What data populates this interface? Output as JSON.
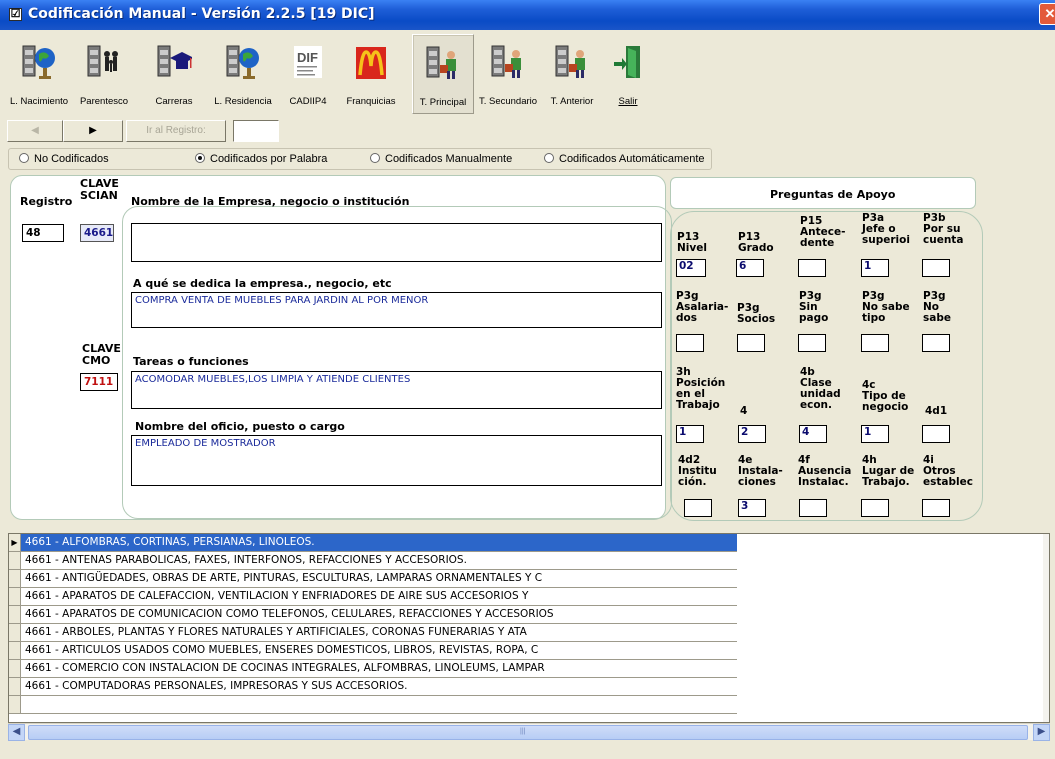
{
  "window": {
    "title": "Codificación Manual - Versión 2.2.5 [19 DIC]",
    "check_glyph": "☑",
    "close_glyph": "✕"
  },
  "toolbar": {
    "items": [
      {
        "label": "L. Nacimiento",
        "icon": "cabinet-globe-icon"
      },
      {
        "label": "Parentesco",
        "icon": "cabinet-family-icon"
      },
      {
        "label": "Carreras",
        "icon": "cabinet-graduation-icon"
      },
      {
        "label": "L. Residencia",
        "icon": "cabinet-globe-icon"
      },
      {
        "label": "CADIIP4",
        "icon": "dif-logo-icon",
        "badge": "DIF"
      },
      {
        "label": "Franquicias",
        "icon": "mcdonalds-icon",
        "badge": "M"
      },
      {
        "label": "T. Principal",
        "icon": "cabinet-worker-icon"
      },
      {
        "label": "T. Secundario",
        "icon": "cabinet-worker-icon"
      },
      {
        "label": "T. Anterior",
        "icon": "cabinet-worker-icon"
      },
      {
        "label": "Salir",
        "icon": "exit-door-icon"
      }
    ],
    "active_index": 6
  },
  "nav": {
    "prev_glyph": "◀",
    "next_glyph": "▶",
    "goto_label": "Ir al Registro:",
    "goto_value": ""
  },
  "filters": {
    "options": [
      "No Codificados",
      "Codificados por Palabra",
      "Codificados Manualmente",
      "Codificados Automáticamente"
    ],
    "selected_index": 1
  },
  "record": {
    "registro_header": "Registro",
    "clave_scian_header": "CLAVE\nSCIAN",
    "empresa_header": "Nombre de la Empresa, negocio o institución",
    "registro_value": "48",
    "clave_scian_value": "4661",
    "empresa_value": "",
    "dedica_label": "A qué se dedica la empresa., negocio, etc",
    "dedica_value": "COMPRA VENTA DE MUEBLES PARA JARDIN AL POR MENOR",
    "clave_cmo_header": "CLAVE\nCMO",
    "clave_cmo_value": "7111",
    "tareas_label": "Tareas o funciones",
    "tareas_value": "ACOMODAR MUEBLES,LOS LIMPIA Y ATIENDE CLIENTES",
    "oficio_label": "Nombre del oficio, puesto o cargo",
    "oficio_value": "EMPLEADO DE MOSTRADOR"
  },
  "apoyo": {
    "title": "Preguntas de Apoyo",
    "questions": [
      {
        "label": "P13\nNivel",
        "value": "02"
      },
      {
        "label": "P13\nGrado",
        "value": "6"
      },
      {
        "label": "P15\nAntece-\ndente",
        "value": ""
      },
      {
        "label": "P3a\nJefe o\nsuperioi",
        "value": "1"
      },
      {
        "label": "P3b\nPor su\ncuenta",
        "value": ""
      },
      {
        "label": "P3g\nAsalaria-\ndos",
        "value": ""
      },
      {
        "label": "P3g\nSocios",
        "value": ""
      },
      {
        "label": "P3g\nSin\npago",
        "value": ""
      },
      {
        "label": "P3g\nNo sabe\ntipo",
        "value": ""
      },
      {
        "label": "P3g\nNo\nsabe",
        "value": ""
      },
      {
        "label": "3h\nPosición\nen el\nTrabajo",
        "value": "1"
      },
      {
        "label": "4",
        "value": "2"
      },
      {
        "label": "4b\nClase\nunidad\necon.",
        "value": "4"
      },
      {
        "label": "4c\nTipo de\nnegocio",
        "value": "1"
      },
      {
        "label": "4d1",
        "value": ""
      },
      {
        "label": "4d2\nInstitu\nción.",
        "value": ""
      },
      {
        "label": "4e\nInstala-\nciones",
        "value": "3"
      },
      {
        "label": "4f\nAusencia\nInstalac.",
        "value": ""
      },
      {
        "label": "4h\nLugar de\nTrabajo.",
        "value": ""
      },
      {
        "label": "4i\nOtros\nestablec",
        "value": ""
      }
    ]
  },
  "results": {
    "selected_index": 0,
    "row_pointer_glyph": "▶",
    "rows": [
      "4661 - ALFOMBRAS, CORTINAS, PERSIANAS, LINOLEOS.",
      "4661 - ANTENAS PARABOLICAS, FAXES, INTERFONOS, REFACCIONES Y ACCESORIOS.",
      "4661 - ANTIGÜEDADES, OBRAS DE ARTE, PINTURAS, ESCULTURAS, LAMPARAS ORNAMENTALES Y C",
      "4661 - APARATOS DE CALEFACCION, VENTILACION Y ENFRIADORES DE AIRE SUS ACCESORIOS Y",
      "4661 - APARATOS DE COMUNICACION COMO TELEFONOS, CELULARES, REFACCIONES Y ACCESORIOS",
      "4661 - ARBOLES, PLANTAS Y FLORES NATURALES Y ARTIFICIALES, CORONAS FUNERARIAS Y ATA",
      "4661 - ARTICULOS USADOS COMO MUEBLES, ENSERES DOMESTICOS, LIBROS, REVISTAS, ROPA, C",
      "4661 - COMERCIO CON INSTALACION DE COCINAS INTEGRALES, ALFOMBRAS, LINOLEUMS, LAMPAR",
      "4661 - COMPUTADORAS PERSONALES, IMPRESORAS Y SUS ACCESORIOS.",
      ""
    ]
  },
  "scrollbar": {
    "left_glyph": "◀",
    "right_glyph": "▶",
    "grip_glyph": "|||"
  }
}
